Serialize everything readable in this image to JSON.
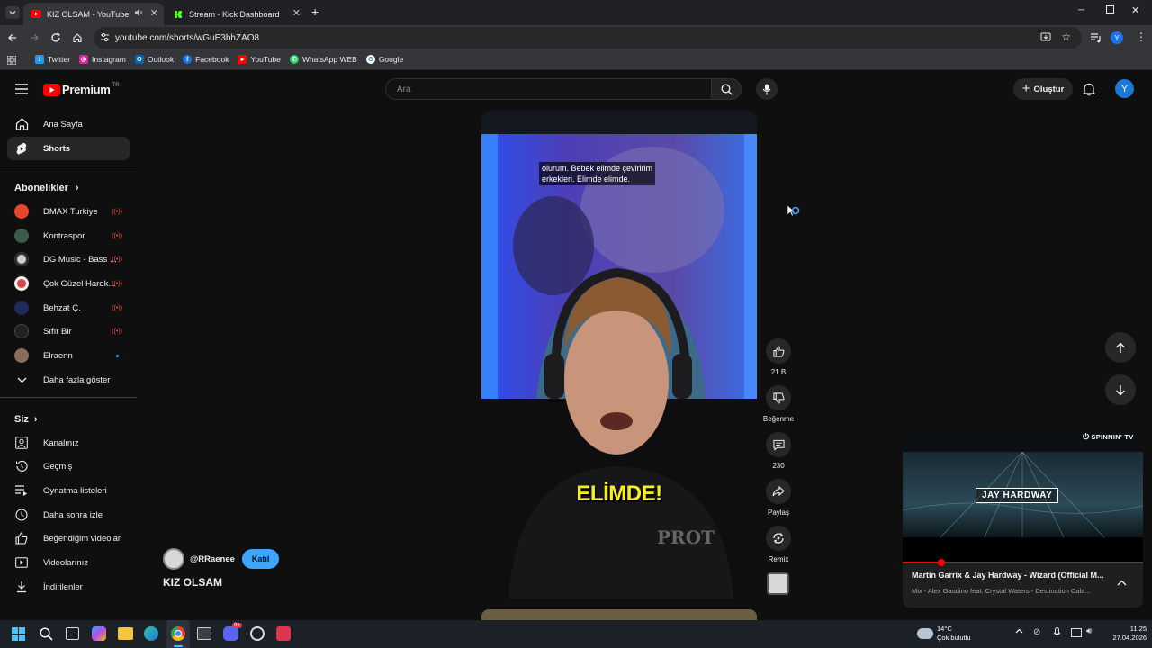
{
  "browser": {
    "tabs": [
      {
        "title": "KIZ OLSAM - YouTube",
        "active": true
      },
      {
        "title": "Stream - Kick Dashboard",
        "active": false
      }
    ],
    "url": "youtube.com/shorts/wGuE3bhZAO8",
    "bookmarks": [
      "Twitter",
      "Instagram",
      "Outlook",
      "Facebook",
      "YouTube",
      "WhatsApp WEB",
      "Google"
    ],
    "profile_initial": "Y"
  },
  "youtube": {
    "logo_text": "Premium",
    "logo_region": "TR",
    "search_placeholder": "Ara",
    "create_label": "Oluştur",
    "avatar_initial": "Y",
    "sidebar": {
      "main": [
        {
          "label": "Ana Sayfa",
          "icon": "home-icon"
        },
        {
          "label": "Shorts",
          "icon": "shorts-icon",
          "active": true
        }
      ],
      "subs_heading": "Abonelikler",
      "subscriptions": [
        {
          "label": "DMAX Turkiye",
          "color": "#e8462a",
          "live": true
        },
        {
          "label": "Kontraspor",
          "color": "#3c5b48",
          "live": true
        },
        {
          "label": "DG Music - Bass ...",
          "color": "#cfcfcf",
          "live": true
        },
        {
          "label": "Çok Güzel Harek...",
          "color": "#d44a4a",
          "live": true
        },
        {
          "label": "Behzat Ç.",
          "color": "#1d2a5a",
          "live": true
        },
        {
          "label": "Sıfır Bir",
          "color": "#222222",
          "live": true
        },
        {
          "label": "Elraenn",
          "color": "#8a6e5a",
          "live": false,
          "dot": true
        }
      ],
      "show_more": "Daha fazla göster",
      "you_heading": "Siz",
      "you_items": [
        {
          "label": "Kanalınız",
          "icon": "channel-icon"
        },
        {
          "label": "Geçmiş",
          "icon": "history-icon"
        },
        {
          "label": "Oynatma listeleri",
          "icon": "playlists-icon"
        },
        {
          "label": "Daha sonra izle",
          "icon": "watch-later-icon"
        },
        {
          "label": "Beğendiğim videolar",
          "icon": "liked-icon"
        },
        {
          "label": "Videolarınız",
          "icon": "your-videos-icon"
        },
        {
          "label": "İndirilenler",
          "icon": "downloads-icon"
        }
      ]
    },
    "short": {
      "caption_line1": "olurum. Bebek elimde çeviririm",
      "caption_line2": "erkekleri. Elimde elimde.",
      "overlay_text": "ELİMDE!",
      "watermark": "PROT",
      "channel": "@RRaenee",
      "join_label": "Katıl",
      "title": "KIZ OLSAM"
    },
    "actions": {
      "likes": "21 B",
      "dislike_label": "Beğenme",
      "comments": "230",
      "share_label": "Paylaş",
      "remix_label": "Remix"
    },
    "miniplayer": {
      "brand": "SPINNIN' TV",
      "thumb_text": "JAY HARDWAY",
      "title": "Martin Garrix & Jay Hardway - Wizard (Official M...",
      "subtitle": "Mix - Alex Gaudino feat. Crystal Waters - Destination Cala...",
      "progress_fraction": 0.16
    }
  },
  "taskbar": {
    "weather_temp": "14°C",
    "weather_desc": "Çok bulutlu",
    "time": "11:25",
    "date": "27.04.2026",
    "discord_badge": "9+"
  }
}
